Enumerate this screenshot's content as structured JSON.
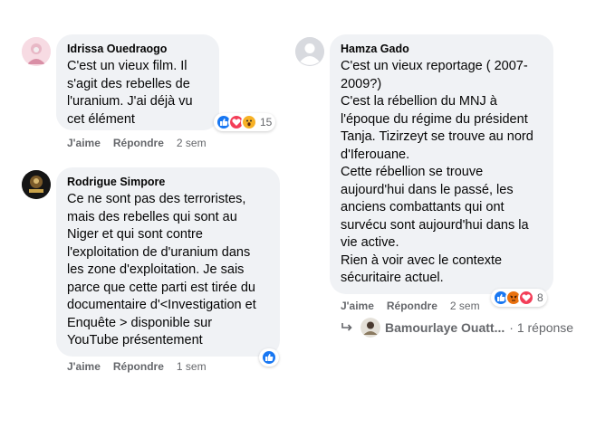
{
  "comments": [
    {
      "author": "Idrissa Ouedraogo",
      "lines": [
        "C'est un vieux film. Il",
        "s'agit des rebelles de",
        "l'uranium. J'ai déjà vu",
        "cet élément"
      ],
      "reaction_count": "15",
      "reactions": [
        "like-icon",
        "love-icon",
        "wow-icon"
      ],
      "like": "J'aime",
      "reply": "Répondre",
      "time": "2 sem"
    },
    {
      "author": "Rodrigue Simpore",
      "lines": [
        "Ce ne sont pas des terroristes,",
        "mais des rebelles qui sont au",
        "Niger et qui sont contre",
        "l'exploitation de d'uranium dans",
        "les zone d'exploitation. Je sais",
        "parce que cette parti est tirée du",
        "documentaire d'<Investigation et",
        "Enquête > disponible sur",
        "YouTube présentement"
      ],
      "reactions": [
        "like-icon"
      ],
      "like": "J'aime",
      "reply": "Répondre",
      "time": "1 sem"
    },
    {
      "author": "Hamza Gado",
      "lines": [
        "C'est un vieux reportage ( 2007-",
        "2009?)",
        "C'est la rébellion du MNJ à",
        "l'époque du régime du président",
        "Tanja. Tizirzeyt se trouve au nord",
        "d'Iferouane.",
        "Cette rébellion se trouve",
        "aujourd'hui dans le passé, les",
        "anciens combattants qui ont",
        "survécu sont aujourd'hui dans la",
        "vie active.",
        "Rien à voir avec le contexte",
        "sécuritaire actuel."
      ],
      "reaction_count": "8",
      "reactions": [
        "like-icon",
        "angry-icon",
        "love-icon"
      ],
      "like": "J'aime",
      "reply": "Répondre",
      "time": "2 sem",
      "reply_preview": {
        "author": "Bamourlaye Ouatt...",
        "count": "· 1 réponse"
      }
    }
  ],
  "colors": {
    "bubble": "#f0f2f5",
    "like": "#1877f2",
    "love": "#f33e58",
    "wow": "#f7b125",
    "angry": "#e9710f",
    "meta": "#65676b"
  }
}
